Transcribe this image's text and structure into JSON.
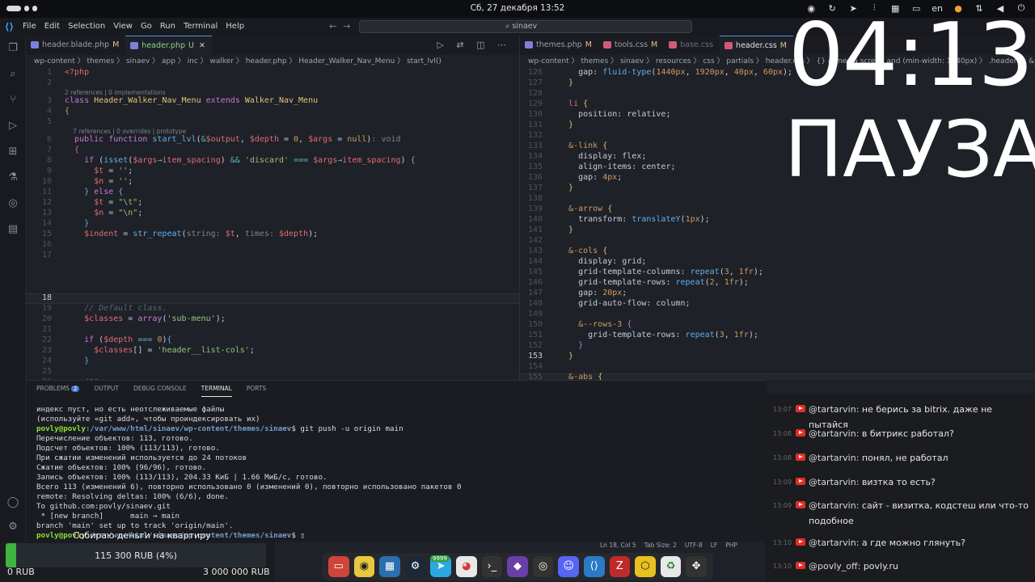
{
  "topbar": {
    "datetime": "Сб, 27 декабря  13:52",
    "lang": "en"
  },
  "menubar": {
    "items": [
      "File",
      "Edit",
      "Selection",
      "View",
      "Go",
      "Run",
      "Terminal",
      "Help"
    ],
    "search": "sinaev"
  },
  "left_editor": {
    "tabs": [
      {
        "label": "header.blade.php",
        "mark": "M"
      },
      {
        "label": "header.php",
        "mark": "U"
      }
    ],
    "breadcrumb": "wp-content 〉 themes 〉 sinaev 〉 app 〉 inc 〉 walker 〉 header.php 〉 Header_Walker_Nav_Menu 〉 start_lvl()",
    "hints": {
      "refs1": "2 references | 0 implementations",
      "refs2": "7 references | 0 overrides | prototype"
    }
  },
  "right_editor": {
    "tabs": [
      {
        "label": "themes.php",
        "mark": "M"
      },
      {
        "label": "tools.css",
        "mark": "M"
      },
      {
        "label": "base.css",
        "mark": ""
      },
      {
        "label": "header.css",
        "mark": "M"
      }
    ],
    "breadcrumb": "wp-content 〉 themes 〉 sinaev 〉 resources 〉 css 〉 partials 〉 header.css 〉 {} @media screen and (min-width: 1440px) 〉 .header 〉 &__list 〉"
  },
  "panel": {
    "tabs": [
      "PROBLEMS",
      "OUTPUT",
      "DEBUG CONSOLE",
      "TERMINAL",
      "PORTS"
    ],
    "problems_count": "2",
    "terminal": [
      "индекс пуст, но есть неотслеживаемые файлы",
      "(используйте «git add», чтобы проиндексировать их)",
      "__PROMPT1__",
      "Перечисление объектов: 113, готово.",
      "Подсчет объектов: 100% (113/113), готово.",
      "При сжатии изменений используется до 24 потоков",
      "Сжатие объектов: 100% (96/96), готово.",
      "Запись объектов: 100% (113/113), 204.33 КиБ | 1.66 МиБ/с, готово.",
      "Всего 113 (изменений 6), повторно использовано 0 (изменений 0), повторно использовано пакетов 0",
      "remote: Resolving deltas: 100% (6/6), done.",
      "To github.com:povly/sinaev.git",
      " * [new branch]      main → main",
      "branch 'main' set up to track 'origin/main'."
    ],
    "prompt_user": "povly@povly",
    "prompt_path": ":/var/www/html/sinaev/wp-content/themes/sinaev",
    "prompt_cmd1": "$ git push -u origin main",
    "prompt_tail": "$"
  },
  "status": {
    "pos": "Ln 18, Col 5",
    "tab": "Tab Size: 2",
    "enc": "UTF-8",
    "eol": "LF",
    "lang": "PHP"
  },
  "overlay": {
    "timer": "04:13",
    "pause": "ПАУЗА"
  },
  "chat": [
    {
      "time": "13:07",
      "nick": "@tartarvin:",
      "text": "не берись за bitrix. даже не пытайся"
    },
    {
      "time": "13:08",
      "nick": "@tartarvin:",
      "text": "в битрикс работал?"
    },
    {
      "time": "13:08",
      "nick": "@tartarvin:",
      "text": "понял, не работал"
    },
    {
      "time": "13:09",
      "nick": "@tartarvin:",
      "text": "визтка то есть?"
    },
    {
      "time": "13:09",
      "nick": "@tartarvin:",
      "text": "сайт - визитка, кодстеш или что-то подобное"
    },
    {
      "time": "13:10",
      "nick": "@tartarvin:",
      "text": "а где можно глянуть?"
    },
    {
      "time": "13:10",
      "nick": "@povly_off:",
      "text": "povly.ru"
    }
  ],
  "goal": {
    "title": "Собираю деньги на квартиру",
    "amount": "115 300 RUB (4%)",
    "min": "0 RUB",
    "max": "3 000 000 RUB",
    "progress": 0.04
  },
  "dock": {
    "badge": "9999"
  },
  "colors": {
    "accent": "#4d8fe0",
    "goal_fill": "#3fb43f",
    "youtube": "#e52d27"
  }
}
